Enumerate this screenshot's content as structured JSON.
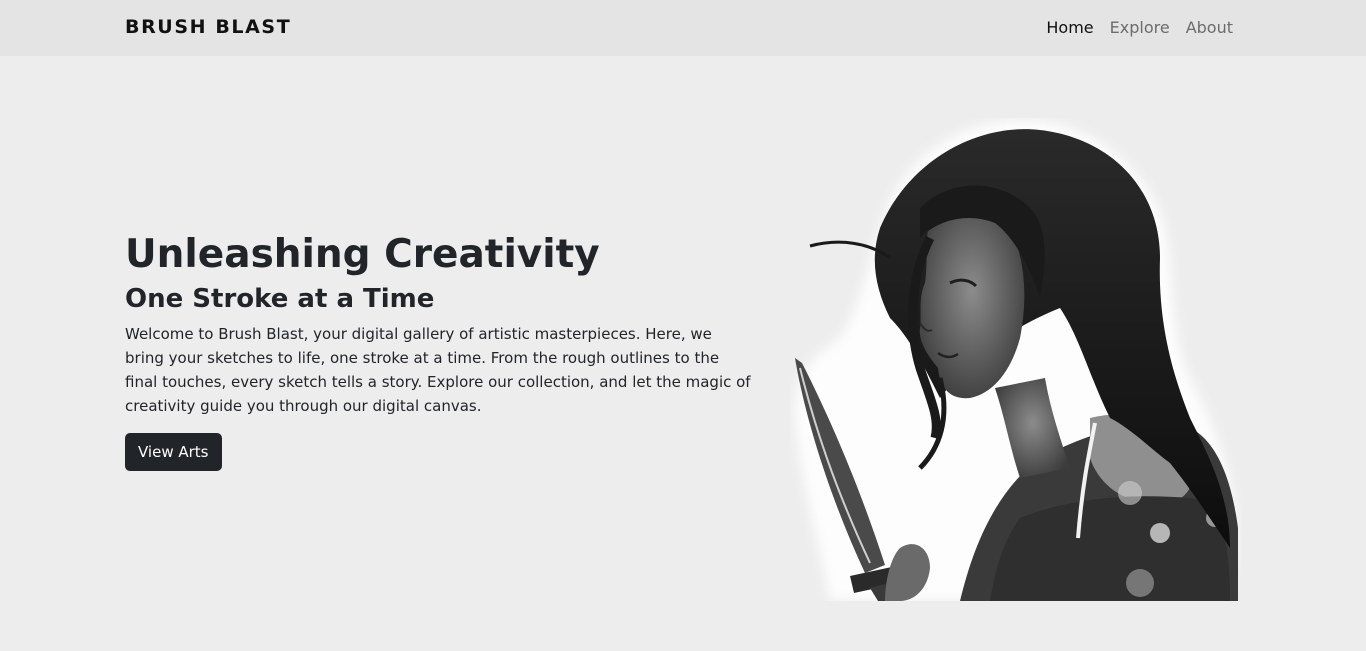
{
  "nav": {
    "brand": "BRUSH BLAST",
    "links": [
      {
        "label": "Home",
        "active": true
      },
      {
        "label": "Explore",
        "active": false
      },
      {
        "label": "About",
        "active": false
      }
    ]
  },
  "hero": {
    "title": "Unleashing Creativity",
    "subtitle": "One Stroke at a Time",
    "description": "Welcome to Brush Blast, your digital gallery of artistic masterpieces. Here, we bring your sketches to life, one stroke at a time. From the rough outlines to the final touches, every sketch tells a story. Explore our collection, and let the magic of creativity guide you through our digital canvas.",
    "button_label": "View Arts"
  }
}
